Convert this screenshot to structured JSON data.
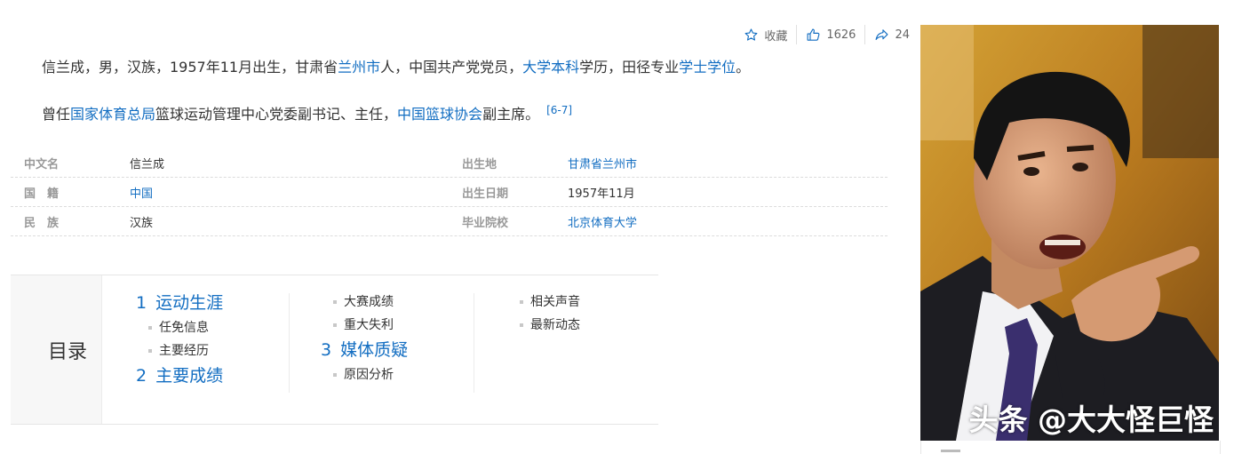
{
  "toolbar": {
    "collect_label": "收藏",
    "like_count": "1626",
    "share_count": "24"
  },
  "summary": {
    "p1": [
      {
        "text": "信兰成，男，汉族，1957年11月出生，甘肃省",
        "link": false
      },
      {
        "text": "兰州市",
        "link": true
      },
      {
        "text": "人，中国共产党党员，",
        "link": false
      },
      {
        "text": "大学本科",
        "link": true
      },
      {
        "text": "学历，田径专业",
        "link": false
      },
      {
        "text": "学士学位",
        "link": true
      },
      {
        "text": "。",
        "link": false
      }
    ],
    "p2": [
      {
        "text": "曾任",
        "link": false
      },
      {
        "text": "国家体育总局",
        "link": true
      },
      {
        "text": "篮球运动管理中心党委副书记、主任，",
        "link": false
      },
      {
        "text": "中国篮球协会",
        "link": true
      },
      {
        "text": "副主席。",
        "link": false
      }
    ],
    "ref": "[6-7]"
  },
  "info": {
    "rows": [
      {
        "k1": "中文名",
        "v1": "信兰成",
        "v1_link": false,
        "k2": "出生地",
        "v2": "甘肃省兰州市",
        "v2_link": true
      },
      {
        "k1": "国　籍",
        "v1": "中国",
        "v1_link": true,
        "k2": "出生日期",
        "v2": "1957年11月",
        "v2_link": false
      },
      {
        "k1": "民　族",
        "v1": "汉族",
        "v1_link": false,
        "k2": "毕业院校",
        "v2": "北京体育大学",
        "v2_link": true
      }
    ]
  },
  "toc": {
    "title": "目录",
    "col1": {
      "s1_num": "1",
      "s1_label": "运动生涯",
      "s1_items": [
        "任免信息",
        "主要经历"
      ],
      "s2_num": "2",
      "s2_label": "主要成绩"
    },
    "col2": {
      "items_top": [
        "大赛成绩",
        "重大失利"
      ],
      "s3_num": "3",
      "s3_label": "媒体质疑",
      "s3_items": [
        "原因分析"
      ]
    },
    "col3": {
      "items": [
        "相关声音",
        "最新动态"
      ]
    }
  },
  "photo": {
    "watermark": "头条 @大大怪巨怪"
  }
}
